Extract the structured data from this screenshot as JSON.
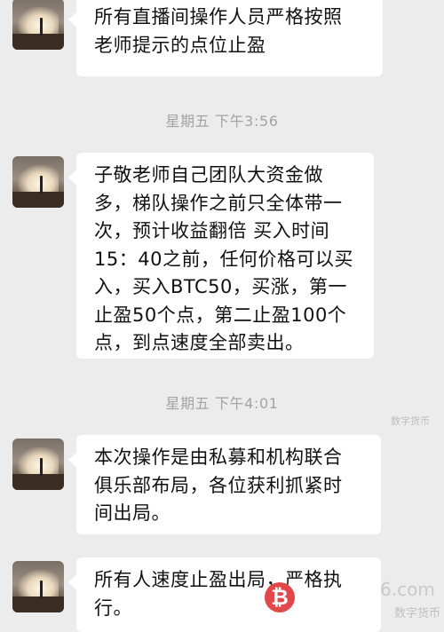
{
  "messages": [
    {
      "text": "所有直播间操作人员严格按照\n老师提示的点位止盈"
    },
    {
      "text": "子敬老师自己团队大资金做\n多，梯队操作之前只全体带一\n次，预计收益翻倍 买入时间\n15：40之前，任何价格可以买\n入，买入BTC50，买涨，第一\n止盈50个点，第二止盈100个\n点，到点速度全部卖出。"
    },
    {
      "text": "本次操作是由私募和机构联合\n俱乐部布局，各位获利抓紧时\n间出局。"
    },
    {
      "text": "所有人速度止盈出局，严格执\n行。"
    }
  ],
  "timestamps": [
    {
      "label": "星期五 下午3:56"
    },
    {
      "label": "星期五 下午4:01"
    }
  ],
  "watermark": {
    "domain_fragment": "6.com",
    "site_name": "数字货币",
    "mid_text": "数字货币",
    "icon_symbol": "₿"
  },
  "colors": {
    "background": "#ececec",
    "bubble": "#ffffff",
    "timestamp": "#a3a3a3",
    "watermark_icon": "#e2484a"
  }
}
